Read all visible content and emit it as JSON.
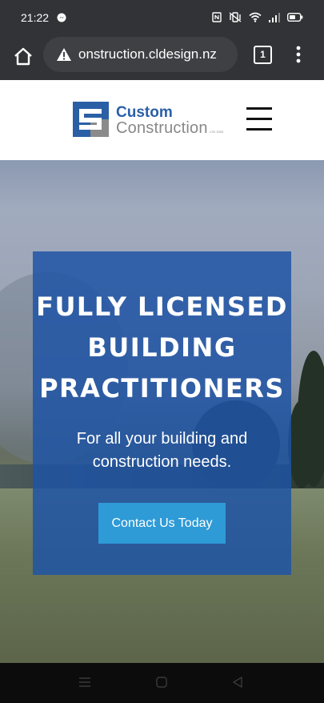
{
  "status_bar": {
    "time": "21:22",
    "icons": [
      "messenger-icon",
      "nfc-icon",
      "vibrate-icon",
      "wifi-icon",
      "signal-icon",
      "battery-icon"
    ]
  },
  "browser": {
    "url": "onstruction.cldesign.nz",
    "tab_count": "1",
    "icons": [
      "home-icon",
      "warning-icon",
      "more-vert-icon"
    ]
  },
  "site_header": {
    "logo_line1": "Custom",
    "logo_line2": "Construction",
    "logo_suffix": "LTD 2020",
    "menu_icon": "hamburger-icon"
  },
  "hero": {
    "title_lines": [
      "FULLY LICENSED",
      "BUILDING",
      "PRACTITIONERS"
    ],
    "subtitle": "For all your building and construction needs.",
    "cta_label": "Contact Us Today",
    "card_color": "#1e53a6",
    "button_color": "#2e9ad6"
  },
  "nav_bar": {
    "icons": [
      "recent-apps-icon",
      "home-circle-icon",
      "back-icon"
    ]
  }
}
